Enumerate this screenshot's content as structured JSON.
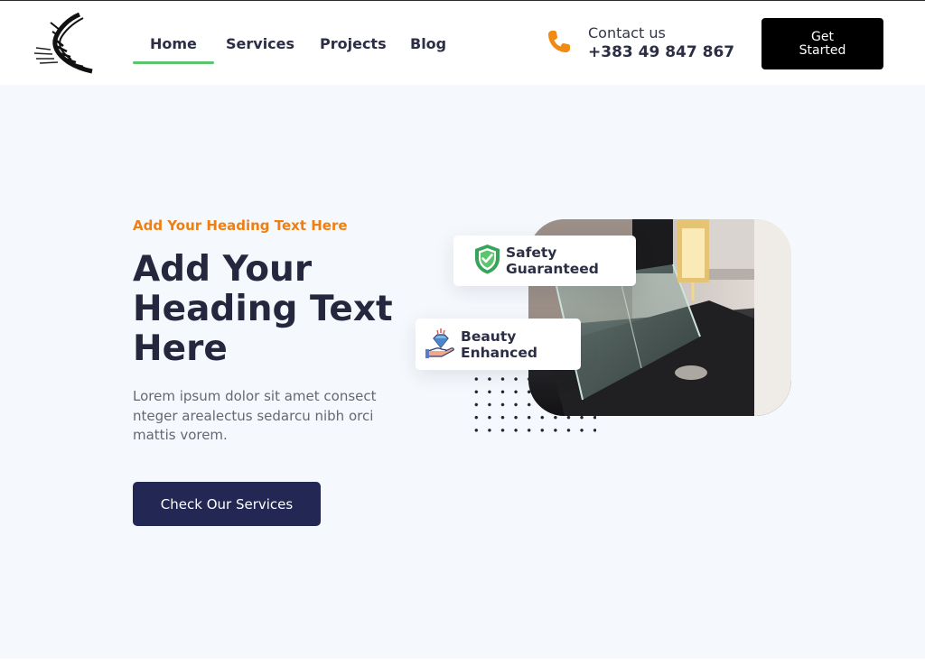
{
  "nav": {
    "items": [
      {
        "label": "Home",
        "active": true
      },
      {
        "label": "Services",
        "active": false
      },
      {
        "label": "Projects",
        "active": false
      },
      {
        "label": "Blog",
        "active": false
      }
    ]
  },
  "contact": {
    "label": "Contact us",
    "phone": "+383 49 847 867",
    "icon": "phone-icon"
  },
  "header_cta": {
    "label": "Get Started"
  },
  "hero": {
    "eyebrow": "Add Your Heading Text Here",
    "title": "Add Your Heading Text Here",
    "lead": "Lorem ipsum dolor sit amet consect nteger arealectus sedarcu nibh orci mattis vorem.",
    "button": "Check Our Services"
  },
  "badges": {
    "safety": "Safety Guaranteed",
    "beauty": "Beauty Enhanced"
  },
  "colors": {
    "accent_orange": "#f07f12",
    "nav_underline": "#5cc46c",
    "button_navy": "#232753",
    "hero_bg": "#f5f8fc"
  }
}
